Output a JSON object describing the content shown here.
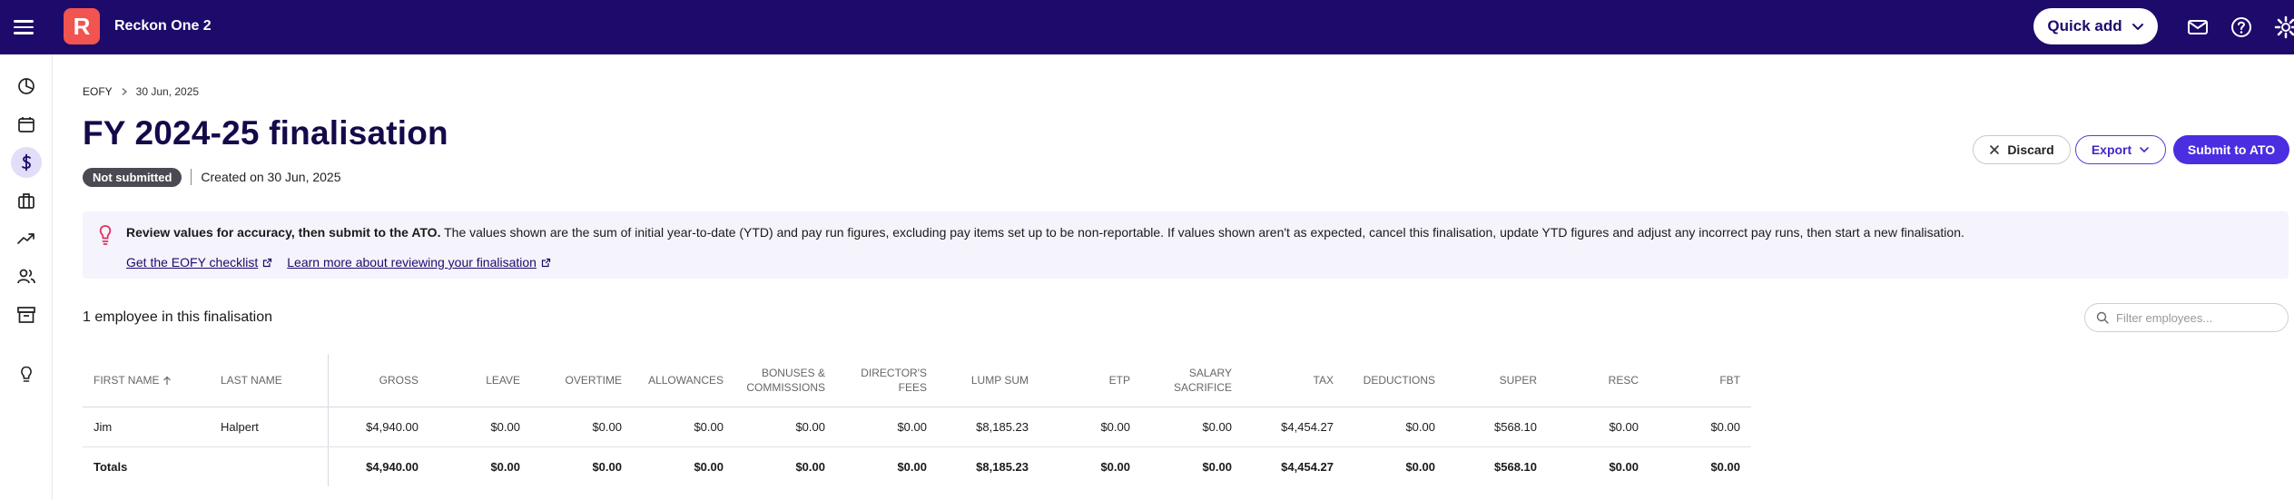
{
  "topbar": {
    "app_title": "Reckon One 2",
    "logo_letter": "R",
    "quick_add_label": "Quick add",
    "colors": {
      "background": "#1e0a6b",
      "logo": "#f25450"
    },
    "icons": [
      "hamburger-icon",
      "mail-icon",
      "help-icon",
      "settings-icon"
    ]
  },
  "sidebar": {
    "items": [
      {
        "icon": "dashboard-icon"
      },
      {
        "icon": "calendar-icon"
      },
      {
        "icon": "dollar-icon",
        "active": true
      },
      {
        "icon": "briefcase-icon"
      },
      {
        "icon": "trending-up-icon"
      },
      {
        "icon": "people-icon"
      },
      {
        "icon": "archive-icon"
      },
      {
        "icon": "lightbulb-icon"
      }
    ]
  },
  "breadcrumb": {
    "parent": "EOFY",
    "current": "30 Jun, 2025"
  },
  "page": {
    "title": "FY 2024-25 finalisation",
    "status_badge": "Not submitted",
    "created_text": "Created on 30 Jun, 2025"
  },
  "actions": {
    "discard_label": "Discard",
    "export_label": "Export",
    "submit_label": "Submit to ATO"
  },
  "banner": {
    "bold_text": "Review values for accuracy, then submit to the ATO.",
    "text": " The values shown are the sum of initial year-to-date (YTD) and pay run figures, excluding pay items set up to be non-reportable. If values shown aren't as expected, cancel this finalisation, update YTD figures and adjust any incorrect pay runs, then start a new finalisation.",
    "link_checklist": "Get the EOFY checklist",
    "link_learn": "Learn more about reviewing your finalisation"
  },
  "employees": {
    "count_label": "1 employee in this finalisation",
    "filter_placeholder": "Filter employees..."
  },
  "table": {
    "headers": {
      "first_name": "FIRST NAME",
      "last_name": "LAST NAME",
      "gross": "GROSS",
      "leave": "LEAVE",
      "overtime": "OVERTIME",
      "allowances": "ALLOWANCES",
      "bonuses_1": "BONUSES &",
      "bonuses_2": "COMMISSIONS",
      "directors_1": "DIRECTOR'S",
      "directors_2": "FEES",
      "lump_sum": "LUMP SUM",
      "etp": "ETP",
      "salary_1": "SALARY",
      "salary_2": "SACRIFICE",
      "tax": "TAX",
      "deductions": "DEDUCTIONS",
      "super": "SUPER",
      "resc": "RESC",
      "fbt": "FBT"
    },
    "rows": [
      {
        "first_name": "Jim",
        "last_name": "Halpert",
        "gross": "$4,940.00",
        "leave": "$0.00",
        "overtime": "$0.00",
        "allowances": "$0.00",
        "bonuses": "$0.00",
        "directors_fees": "$0.00",
        "lump_sum": "$8,185.23",
        "etp": "$0.00",
        "salary_sacrifice": "$0.00",
        "tax": "$4,454.27",
        "deductions": "$0.00",
        "super": "$568.10",
        "resc": "$0.00",
        "fbt": "$0.00"
      }
    ],
    "totals": {
      "label": "Totals",
      "gross": "$4,940.00",
      "leave": "$0.00",
      "overtime": "$0.00",
      "allowances": "$0.00",
      "bonuses": "$0.00",
      "directors_fees": "$0.00",
      "lump_sum": "$8,185.23",
      "etp": "$0.00",
      "salary_sacrifice": "$0.00",
      "tax": "$4,454.27",
      "deductions": "$0.00",
      "super": "$568.10",
      "resc": "$0.00",
      "fbt": "$0.00"
    }
  }
}
